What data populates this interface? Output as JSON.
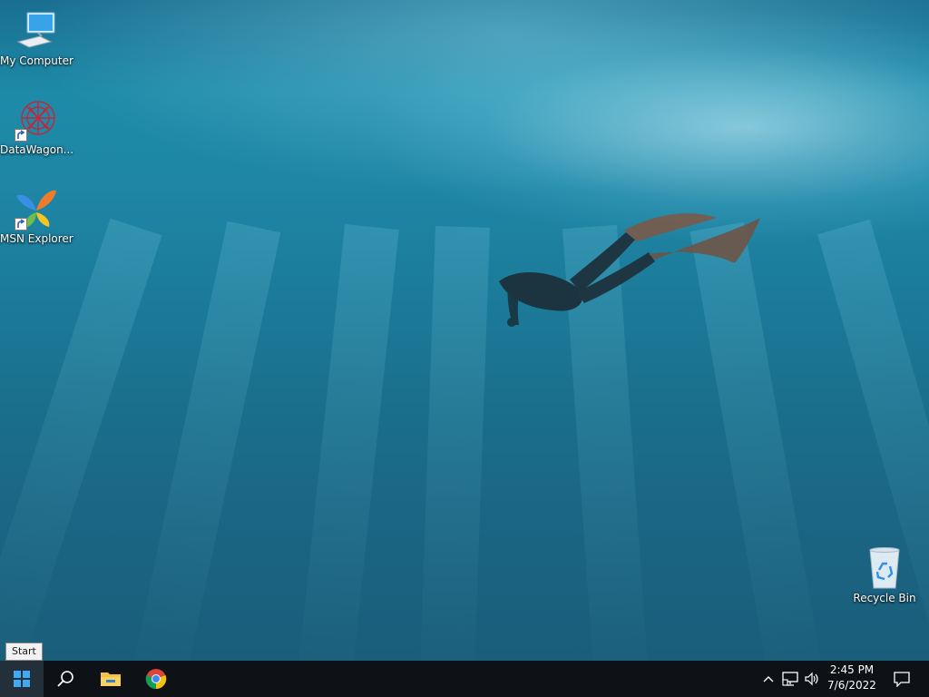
{
  "desktop": {
    "icons": [
      {
        "label": "My Computer",
        "icon": "computer-icon"
      },
      {
        "label": "DataWagon...",
        "icon": "datawagon-icon"
      },
      {
        "label": "MSN Explorer",
        "icon": "msn-butterfly-icon"
      },
      {
        "label": "Recycle Bin",
        "icon": "recycle-bin-icon"
      }
    ]
  },
  "tooltip": {
    "text": "Start"
  },
  "taskbar": {
    "start_icon": "windows-logo-icon",
    "search_icon": "search-icon",
    "pinned": [
      {
        "name": "File Explorer",
        "icon": "folder-icon"
      },
      {
        "name": "Google Chrome",
        "icon": "chrome-icon"
      }
    ],
    "tray": {
      "icons": [
        "chevron-up-icon",
        "network-icon",
        "volume-icon"
      ],
      "time": "2:45 PM",
      "date": "7/6/2022",
      "notification_icon": "action-center-icon"
    }
  },
  "colors": {
    "taskbar_bg": "#0e1216",
    "start_bg": "#23303a",
    "ocean": "#1d8aa8"
  }
}
